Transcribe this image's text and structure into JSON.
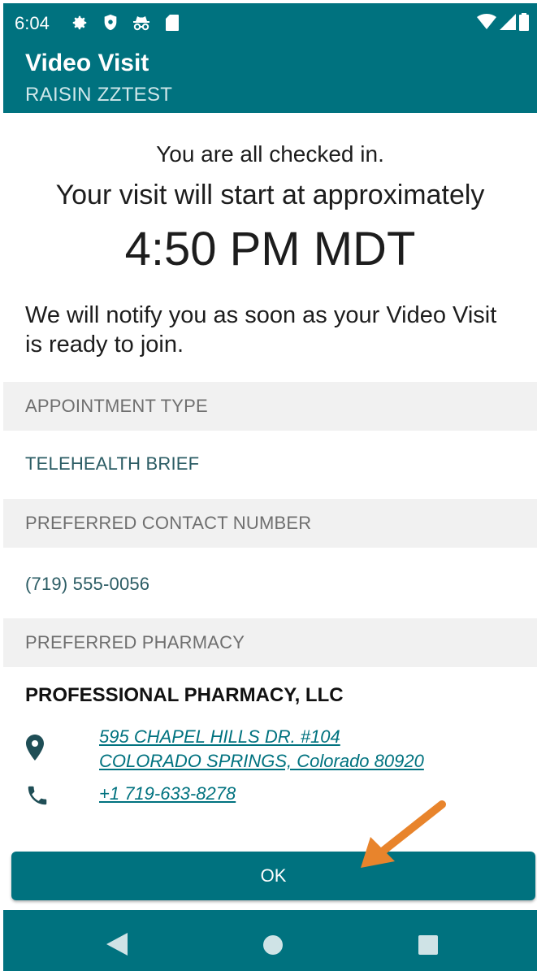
{
  "status_bar": {
    "time": "6:04",
    "icons": [
      "gear-icon",
      "shield-icon",
      "incognito-icon",
      "sd-card-icon"
    ],
    "right_icons": [
      "wifi-icon",
      "signal-icon",
      "battery-icon"
    ]
  },
  "app_bar": {
    "title": "Video Visit",
    "subtitle": "RAISIN ZZTEST",
    "color": "#00727f"
  },
  "main": {
    "checked_in": "You are all checked in.",
    "start_text": "Your visit will start at approximately",
    "start_time": "4:50 PM MDT",
    "notify": "We will notify you as soon as your Video Visit is ready to join."
  },
  "details": {
    "appointment_type_label": "APPOINTMENT TYPE",
    "appointment_type_value": "TELEHEALTH BRIEF",
    "contact_label": "PREFERRED CONTACT NUMBER",
    "contact_value": "(719) 555-0056",
    "pharmacy_label": "PREFERRED PHARMACY",
    "pharmacy_name": "PROFESSIONAL PHARMACY, LLC",
    "pharmacy_address_line1": "595 CHAPEL HILLS DR. #104",
    "pharmacy_address_line2": "COLORADO SPRINGS, Colorado 80920",
    "pharmacy_phone": "+1 719-633-8278"
  },
  "actions": {
    "ok_label": "OK",
    "annotation_arrow_color": "#e8842c"
  },
  "nav_bar": {
    "icons": [
      "back-icon",
      "home-icon",
      "recents-icon"
    ]
  }
}
